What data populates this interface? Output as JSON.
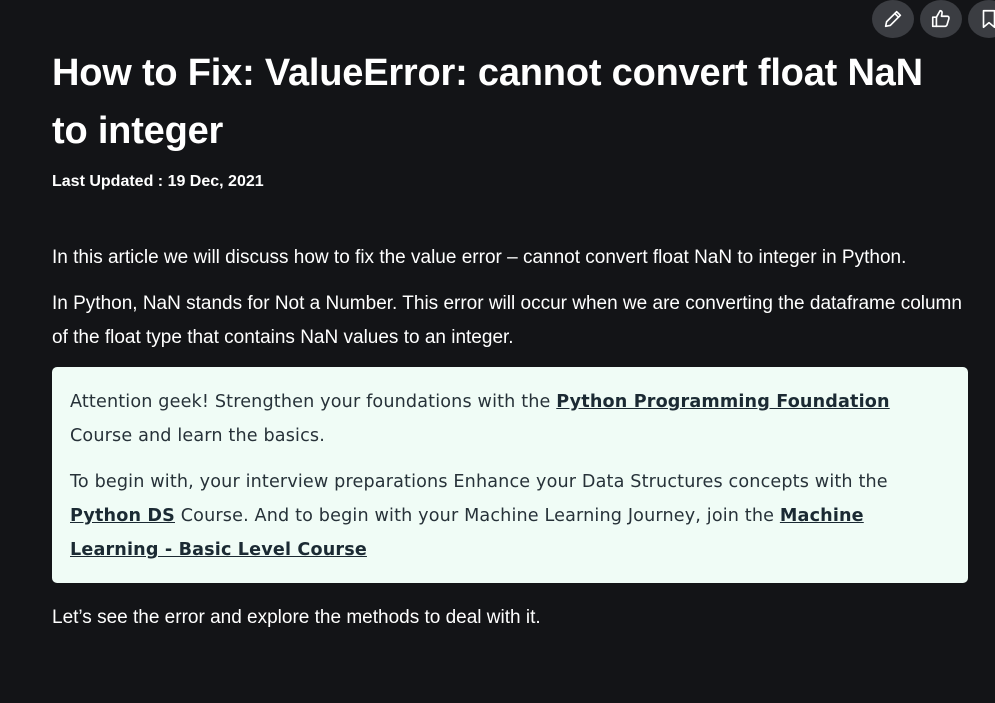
{
  "toolbar": {
    "icons": [
      "edit-icon",
      "like-icon",
      "bookmark-icon"
    ]
  },
  "article": {
    "title": "How to Fix: ValueError: cannot convert float NaN to integer",
    "updated_label": "Last Updated : ",
    "updated_date": "19 Dec, 2021",
    "paragraphs": [
      "In this article we will discuss how to fix the value error – cannot convert float NaN to integer in Python.",
      "In Python, NaN stands for Not a Number. This error will occur when we are converting the dataframe column of the float type that contains NaN values to an integer.",
      "Let’s see the error and explore the methods to deal with it."
    ]
  },
  "promo": {
    "line1_prefix": " Attention geek! Strengthen your foundations with the ",
    "line1_link": "Python Programming Foundation",
    "line1_suffix": " Course and learn the basics.",
    "line2_prefix": "To begin with, your interview preparations Enhance your Data Structures concepts with the ",
    "line2_link1": "Python DS",
    "line2_middle": " Course. And to begin with your Machine Learning Journey, join the ",
    "line2_link2": "Machine Learning - Basic Level Course",
    "background": "#f0fcf6"
  },
  "colors": {
    "page_background": "#131417",
    "text": "#ffffff",
    "promo_text": "#273239"
  }
}
